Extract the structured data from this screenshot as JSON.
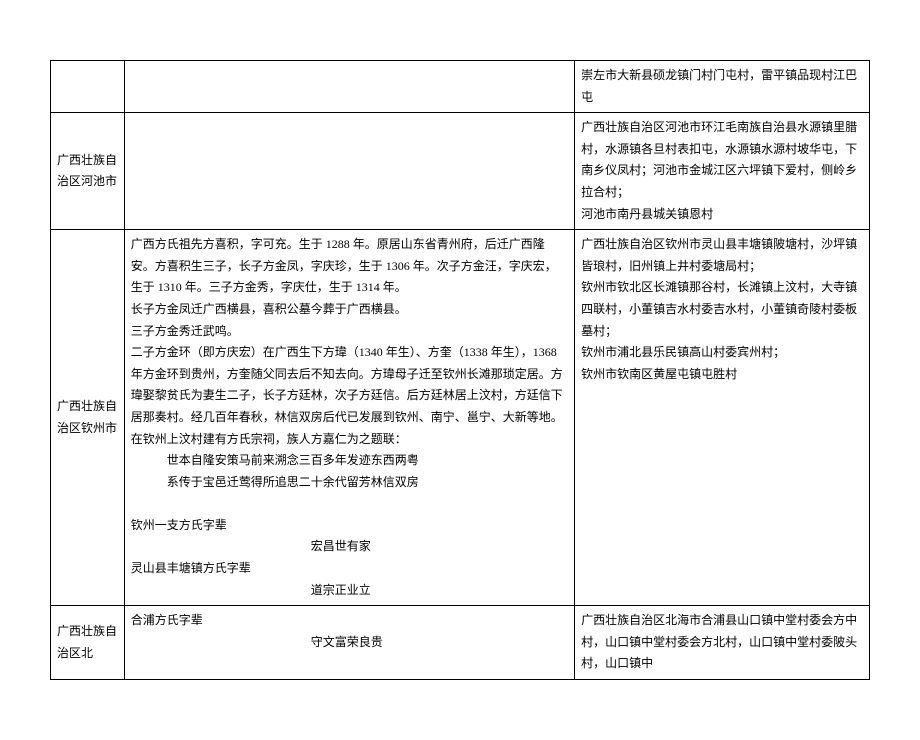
{
  "rows": [
    {
      "region": "",
      "middle": "",
      "right": "崇左市大新县硕龙镇门村门屯村，雷平镇品现村江巴屯"
    },
    {
      "region": "广西壮族自治区河池市",
      "middle": "",
      "right_lines": [
        "广西壮族自治区河池市环江毛南族自治县水源镇里腊村，水源镇各旦村表扣屯，水源镇水源村坡华屯，下南乡仪凤村；河池市金城江区六坪镇下爱村，侧岭乡拉合村；",
        "河池市南丹县城关镇恩村"
      ]
    },
    {
      "region": "广西壮族自治区钦州市",
      "middle_lines": [
        "广西方氏祖先方喜积，字可充。生于 1288 年。原居山东省青州府，后迁广西隆安。方喜积生三子，长子方金凤，字庆珍，生于 1306 年。次子方金汪，字庆宏，生于 1310 年。三子方金秀，字庆仕，生于 1314 年。",
        "长子方金凤迁广西横县，喜积公墓今葬于广西横县。",
        "三子方金秀迁武鸣。",
        "二子方金环（即方庆宏）在广西生下方瑋（1340 年生）、方奎（1338 年生），1368 年方金环到贵州，方奎随父同去后不知去向。方瑋母子迁至钦州长滩那琐定居。方瑋娶黎贫氏为妻生二子，长子方廷林，次子方廷信。后方廷林居上汶村，方廷信下居那奏村。经几百年春秋，林信双房后代已发展到钦州、南宁、邕宁、大新等地。在钦州上汶村建有方氏宗祠，族人方嘉仁为之题联："
      ],
      "middle_indents": [
        "世本自隆安策马前来溯念三百多年发迹东西两粤",
        "系传于宝邑迁莺得所追思二十余代留芳林信双房"
      ],
      "middle_sub1": "钦州一支方氏字辈",
      "middle_sub1_v": "宏昌世有家",
      "middle_sub2": "灵山县丰塘镇方氏字辈",
      "middle_sub2_v": "道宗正业立",
      "right_lines": [
        "广西壮族自治区钦州市灵山县丰塘镇陂塘村，沙坪镇皆琅村，旧州镇上井村委塘局村；",
        "钦州市钦北区长滩镇那谷村，长滩镇上汶村，大寺镇四联村，小董镇吉水村委吉水村，小董镇奇陵村委板墓村；",
        "钦州市浦北县乐民镇高山村委宾州村；",
        "钦州市钦南区黄屋屯镇屯胜村"
      ]
    },
    {
      "region": "广西壮族自治区北",
      "middle_sub1": "合浦方氏字辈",
      "middle_sub1_v": "守文富荣良贵",
      "right": "广西壮族自治区北海市合浦县山口镇中堂村委会方中村，山口镇中堂村委会方北村，山口镇中堂村委陂头村，山口镇中"
    }
  ]
}
